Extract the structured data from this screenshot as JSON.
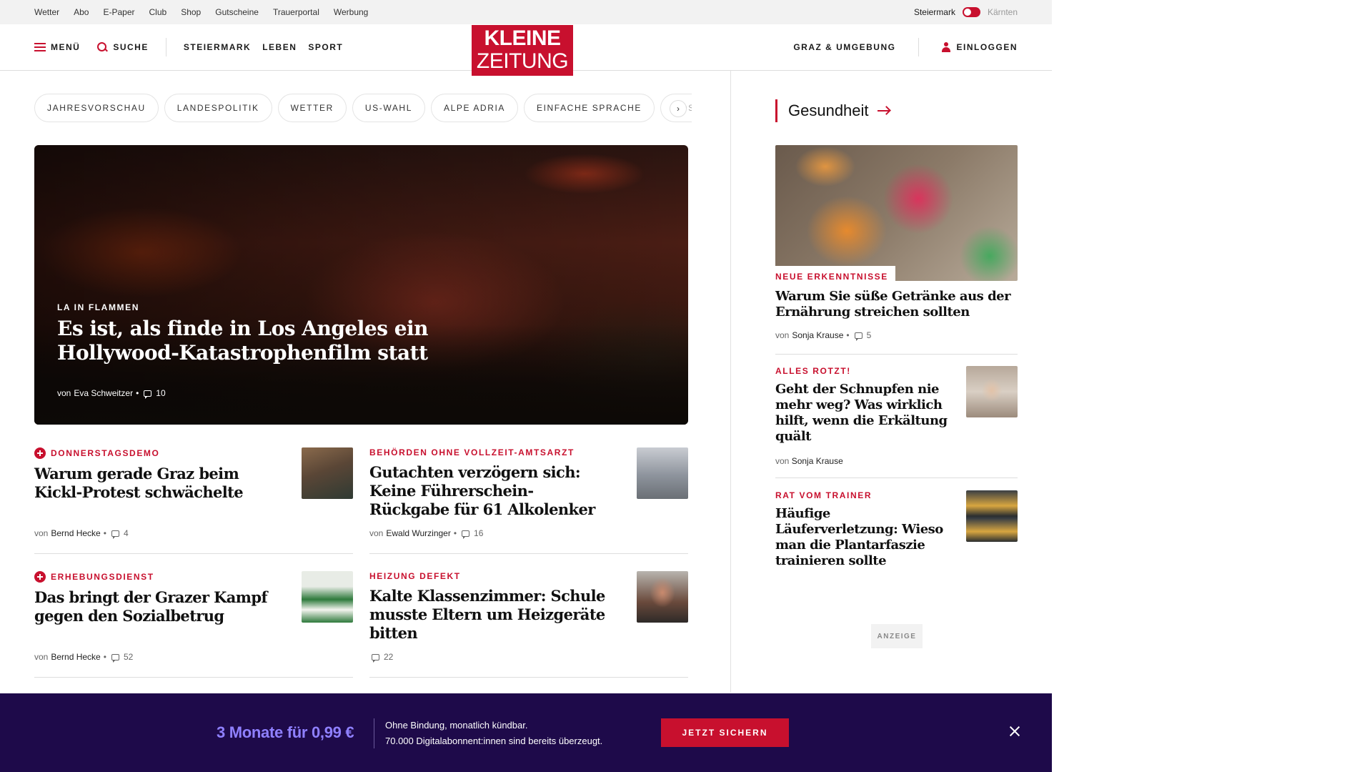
{
  "topbar": {
    "links": [
      "Wetter",
      "Abo",
      "E-Paper",
      "Club",
      "Shop",
      "Gutscheine",
      "Trauerportal",
      "Werbung"
    ],
    "region_active": "Steiermark",
    "region_inactive": "Kärnten"
  },
  "header": {
    "menu_label": "MENÜ",
    "search_label": "SUCHE",
    "nav": [
      "STEIERMARK",
      "LEBEN",
      "SPORT"
    ],
    "logo_line1": "KLEINE",
    "logo_line2": "ZEITUNG",
    "region_link": "GRAZ & UMGEBUNG",
    "login_label": "EINLOGGEN"
  },
  "topics": [
    "JAHRESVORSCHAU",
    "LANDESPOLITIK",
    "WETTER",
    "US-WAHL",
    "ALPE ADRIA",
    "EINFACHE SPRACHE",
    "DOS"
  ],
  "hero": {
    "kicker": "LA IN FLAMMEN",
    "title": "Es ist, als finde in Los Angeles ein Hollywood-Katastrophenfilm statt",
    "by": "von",
    "author": "Eva Schweitzer",
    "comments": "10"
  },
  "articles": [
    {
      "kicker": "DONNERSTAGSDEMO",
      "premium": true,
      "title": "Warum gerade Graz beim Kickl-Protest schwächelte",
      "by": "von",
      "author": "Bernd Hecke",
      "comments": "4"
    },
    {
      "kicker": "BEHÖRDEN OHNE VOLLZEIT-AMTSARZT",
      "premium": false,
      "title": "Gutachten verzögern sich: Keine Führerschein-Rückgabe für 61 Alkolenker",
      "by": "von",
      "author": "Ewald Wurzinger",
      "comments": "16"
    },
    {
      "kicker": "ERHEBUNGSDIENST",
      "premium": true,
      "title": "Das bringt der Grazer Kampf gegen den Sozialbetrug",
      "by": "von",
      "author": "Bernd Hecke",
      "comments": "52"
    },
    {
      "kicker": "HEIZUNG DEFEKT",
      "premium": false,
      "title": "Kalte Klassenzimmer: Schule musste Eltern um Heizgeräte bitten",
      "comments": "22"
    }
  ],
  "sidebar": {
    "heading": "Gesundheit",
    "feature": {
      "kicker": "NEUE ERKENNTNISSE",
      "title": "Warum Sie süße Getränke aus der Ernährung streichen sollten",
      "by": "von",
      "author": "Sonja Krause",
      "comments": "5"
    },
    "items": [
      {
        "kicker": "ALLES ROTZT!",
        "title": "Geht der Schnupfen nie mehr weg? Was wirklich hilft, wenn die Erkältung quält",
        "by": "von",
        "author": "Sonja Krause"
      },
      {
        "kicker": "RAT VOM TRAINER",
        "title": "Häufige Läuferverletzung: Wieso man die Plantarfaszie trainieren sollte"
      }
    ],
    "ad_label": "ANZEIGE"
  },
  "banner": {
    "price": "3 Monate für 0,99 €",
    "line1": "Ohne Bindung, monatlich kündbar.",
    "line2": "70.000 Digitalabonnent:innen sind bereits überzeugt.",
    "cta": "JETZT SICHERN"
  },
  "colors": {
    "brand_red": "#c8102e",
    "banner_bg": "#1e0a4a",
    "banner_price": "#8f80ff"
  },
  "icons": [
    "menu-icon",
    "search-icon",
    "user-icon",
    "chevron-right-icon",
    "comment-icon",
    "plus-icon",
    "arrow-right-icon",
    "close-icon"
  ]
}
